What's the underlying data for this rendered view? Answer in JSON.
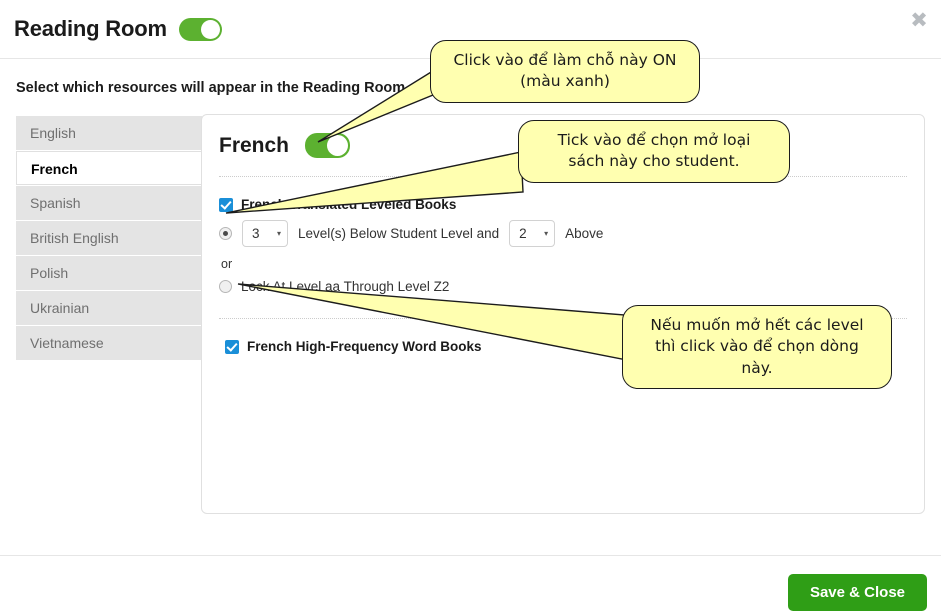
{
  "header": {
    "title": "Reading Room",
    "toggle_on": true,
    "close_icon": "close-icon",
    "close_label": "✖"
  },
  "instruction": "Select which resources will appear in the Reading Room.",
  "sidebar": {
    "items": [
      {
        "label": "English",
        "selected": false
      },
      {
        "label": "French",
        "selected": true
      },
      {
        "label": "Spanish",
        "selected": false
      },
      {
        "label": "British English",
        "selected": false
      },
      {
        "label": "Polish",
        "selected": false
      },
      {
        "label": "Ukrainian",
        "selected": false
      },
      {
        "label": "Vietnamese",
        "selected": false
      }
    ]
  },
  "panel": {
    "language": "French",
    "language_toggle_on": true,
    "leveled_books": {
      "checkbox_label": "French Translated Leveled Books",
      "checked": true,
      "range_option_selected": true,
      "below_value": "3",
      "middle_text": "Level(s) Below Student Level and",
      "above_value": "2",
      "after_text": "Above",
      "or_text": "or",
      "lock_option_selected": false,
      "lock_label": "Lock At Level aa Through Level Z2",
      "caret": "▾"
    },
    "high_frequency": {
      "checkbox_label": "French High-Frequency Word Books",
      "checked": true
    }
  },
  "footer": {
    "save_label": "Save & Close"
  },
  "callouts": [
    {
      "line1": "Click vào để làm chỗ này ON",
      "line2": "(màu xanh)",
      "line3": ""
    },
    {
      "line1": "Tick vào để chọn mở loại",
      "line2": "sách này cho student.",
      "line3": ""
    },
    {
      "line1": "Nếu muốn mở hết các level",
      "line2": "thì click vào để chọn dòng",
      "line3": "này."
    }
  ],
  "colors": {
    "toggle_green": "#5cb130",
    "save_green": "#2f9e16",
    "checkbox_blue": "#1a8fd8",
    "callout_yellow": "#ffffb0"
  }
}
